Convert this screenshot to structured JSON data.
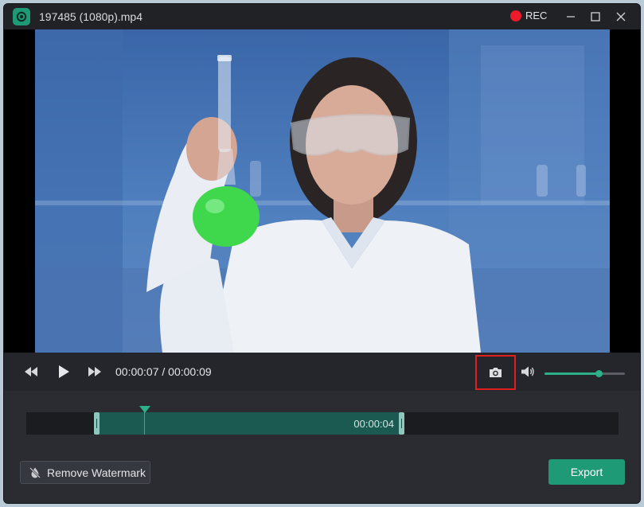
{
  "window": {
    "title": "197485 (1080p).mp4",
    "rec_label": "REC"
  },
  "player": {
    "current_time": "00:00:07",
    "separator": " / ",
    "total_time": "00:00:09",
    "volume_fraction": 0.67
  },
  "timeline": {
    "selection_duration": "00:00:04"
  },
  "actions": {
    "remove_watermark_label": "Remove Watermark",
    "export_label": "Export"
  },
  "colors": {
    "accent": "#1e9a77",
    "rec": "#ec1a2a",
    "highlight_box": "#e01f1f"
  },
  "icons": {
    "rewind": "rewind-icon",
    "play": "play-icon",
    "forward": "fast-forward-icon",
    "snapshot": "camera-icon",
    "volume": "volume-icon",
    "watermark": "watermark-droplet-icon"
  }
}
